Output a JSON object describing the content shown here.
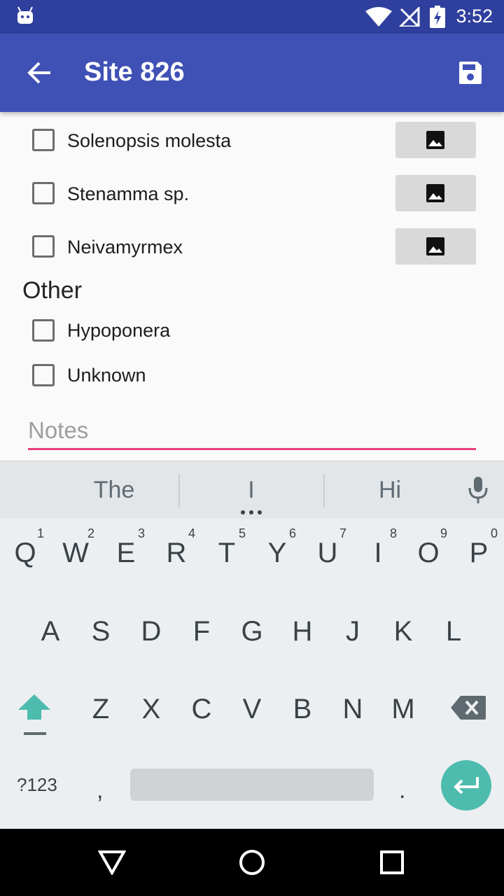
{
  "status_bar": {
    "time": "3:52",
    "icons": [
      "android-debug-icon",
      "wifi-icon",
      "no-signal-icon",
      "battery-charging-icon"
    ]
  },
  "app_bar": {
    "title": "Site 826",
    "icons": [
      "back-arrow-icon",
      "save-icon"
    ]
  },
  "species_list": {
    "items": [
      {
        "label": "Solenopsis molesta",
        "checked": false,
        "has_image_button": true
      },
      {
        "label": "Stenamma sp.",
        "checked": false,
        "has_image_button": true
      },
      {
        "label": "Neivamyrmex",
        "checked": false,
        "has_image_button": true
      }
    ]
  },
  "other_section": {
    "title": "Other",
    "items": [
      {
        "label": "Hypoponera",
        "checked": false
      },
      {
        "label": "Unknown",
        "checked": false
      }
    ]
  },
  "notes": {
    "placeholder": "Notes",
    "value": "",
    "underline_color": "#e83e7e"
  },
  "keyboard": {
    "suggestions": [
      "The",
      "I",
      "Hi"
    ],
    "row1": [
      "Q",
      "W",
      "E",
      "R",
      "T",
      "Y",
      "U",
      "I",
      "O",
      "P"
    ],
    "row1_hints": [
      "1",
      "2",
      "3",
      "4",
      "5",
      "6",
      "7",
      "8",
      "9",
      "0"
    ],
    "row2": [
      "A",
      "S",
      "D",
      "F",
      "G",
      "H",
      "J",
      "K",
      "L"
    ],
    "row3": [
      "Z",
      "X",
      "C",
      "V",
      "B",
      "N",
      "M"
    ],
    "symbols_label": "?123",
    "comma": ",",
    "period": ".",
    "enter_color": "#4dbcae",
    "shift_color": "#4dbcae"
  },
  "colors": {
    "app_bar": "#3f51b5",
    "status_bar": "#2f3f9e",
    "accent": "#e83e7e"
  }
}
